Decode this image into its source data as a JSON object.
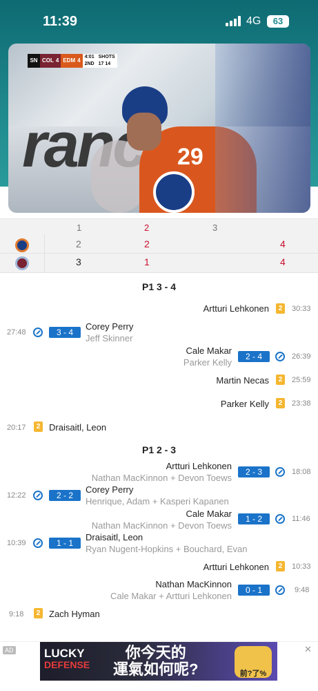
{
  "status_bar": {
    "time": "11:39",
    "network": "4G",
    "battery": "63"
  },
  "video": {
    "scorebug": {
      "network_logo": "SN",
      "away_team": "COL",
      "away_score": "4",
      "home_team": "EDM",
      "home_score": "4",
      "clock": "4:01",
      "period": "2ND",
      "shots_label": "SHOTS",
      "away_shots": "17",
      "home_shots": "14"
    },
    "jersey_number": "29"
  },
  "period_table": {
    "headers": [
      "1",
      "2",
      "3"
    ],
    "teams": [
      {
        "logo": "oilers-logo-icon",
        "p1": "2",
        "p2": "2",
        "total": "4"
      },
      {
        "logo": "avalanche-logo-icon",
        "p1": "3",
        "p2": "1",
        "total": "4"
      }
    ]
  },
  "sections": [
    {
      "title": "P1 3 - 4"
    },
    {
      "title": "P1 2 - 3"
    }
  ],
  "events": [
    {
      "time": "30:33",
      "name": "Artturi Lehkonen",
      "badge": "2"
    },
    {
      "time": "27:48",
      "score": "3 - 4",
      "name": "Corey Perry",
      "assist": "Jeff Skinner"
    },
    {
      "time": "26:39",
      "score": "2 - 4",
      "name": "Cale Makar",
      "assist": "Parker Kelly"
    },
    {
      "time": "25:59",
      "name": "Martin Necas",
      "badge": "2"
    },
    {
      "time": "23:38",
      "name": "Parker Kelly",
      "badge": "2"
    },
    {
      "time": "20:17",
      "name": "Draisaitl, Leon",
      "badge": "2"
    },
    {
      "time": "18:08",
      "score": "2 - 3",
      "name": "Artturi Lehkonen",
      "assist": "Nathan MacKinnon + Devon Toews"
    },
    {
      "time": "12:22",
      "score": "2 - 2",
      "name": "Corey Perry",
      "assist": "Henrique, Adam + Kasperi Kapanen"
    },
    {
      "time": "11:46",
      "score": "1 - 2",
      "name": "Cale Makar",
      "assist": "Nathan MacKinnon + Devon Toews"
    },
    {
      "time": "10:39",
      "score": "1 - 1",
      "name": "Draisaitl, Leon",
      "assist": "Ryan Nugent-Hopkins + Bouchard, Evan"
    },
    {
      "time": "10:33",
      "name": "Artturi Lehkonen",
      "badge": "2"
    },
    {
      "time": "9:48",
      "score": "0 - 1",
      "name": "Nathan MacKinnon",
      "assist": "Cale Makar + Artturi Lehkonen"
    },
    {
      "time": "9:18",
      "name": "Zach Hyman",
      "badge": "2"
    }
  ],
  "ad": {
    "tag": "AD",
    "brand_line1": "LUCKY",
    "brand_line2": "DEFENSE",
    "slogan_line1": "你今天的",
    "slogan_line2": "運氣如何呢?",
    "mascot_text": "前?了%"
  },
  "colors": {
    "header_teal": "#1f8a8e",
    "goal_blue": "#1a73c9",
    "penalty_yellow": "#f5b630",
    "score_red": "#c8102e"
  }
}
